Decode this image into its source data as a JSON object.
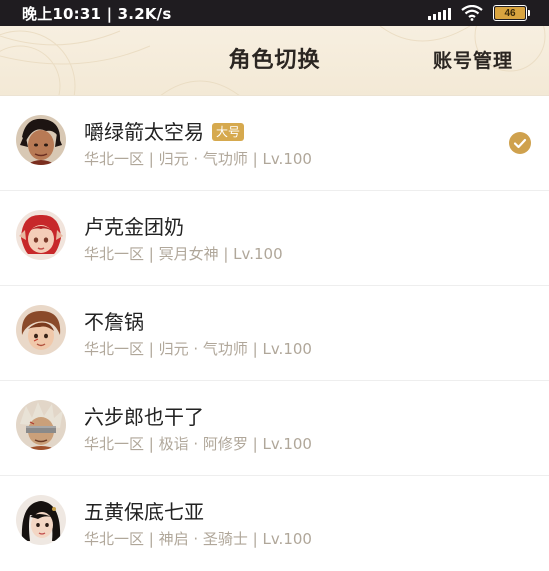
{
  "status_bar": {
    "time_speed": "晚上10:31 | 3.2K/s",
    "battery_level": "46",
    "battery_color": "#d9a43f"
  },
  "header": {
    "title": "角色切换",
    "account_manage_label": "账号管理"
  },
  "characters": [
    {
      "name": "嚼绿箭太空易",
      "badge": "大号",
      "info": "华北一区 | 归元 · 气功师 | Lv.100",
      "selected": true,
      "avatar_icon": "avatar-dark-hair-male"
    },
    {
      "name": "卢克金团奶",
      "info": "华北一区 | 冥月女神 | Lv.100",
      "selected": false,
      "avatar_icon": "avatar-red-hair-female"
    },
    {
      "name": "不詹锅",
      "info": "华北一区 | 归元 · 气功师 | Lv.100",
      "selected": false,
      "avatar_icon": "avatar-brown-hair-female"
    },
    {
      "name": "六步郎也干了",
      "info": "华北一区 | 极诣 · 阿修罗 | Lv.100",
      "selected": false,
      "avatar_icon": "avatar-blindfold-male"
    },
    {
      "name": "五黄保底七亚",
      "info": "华北一区 | 神启 · 圣骑士 | Lv.100",
      "selected": false,
      "avatar_icon": "avatar-black-hair-female"
    }
  ],
  "accent_color": "#cfa14d"
}
